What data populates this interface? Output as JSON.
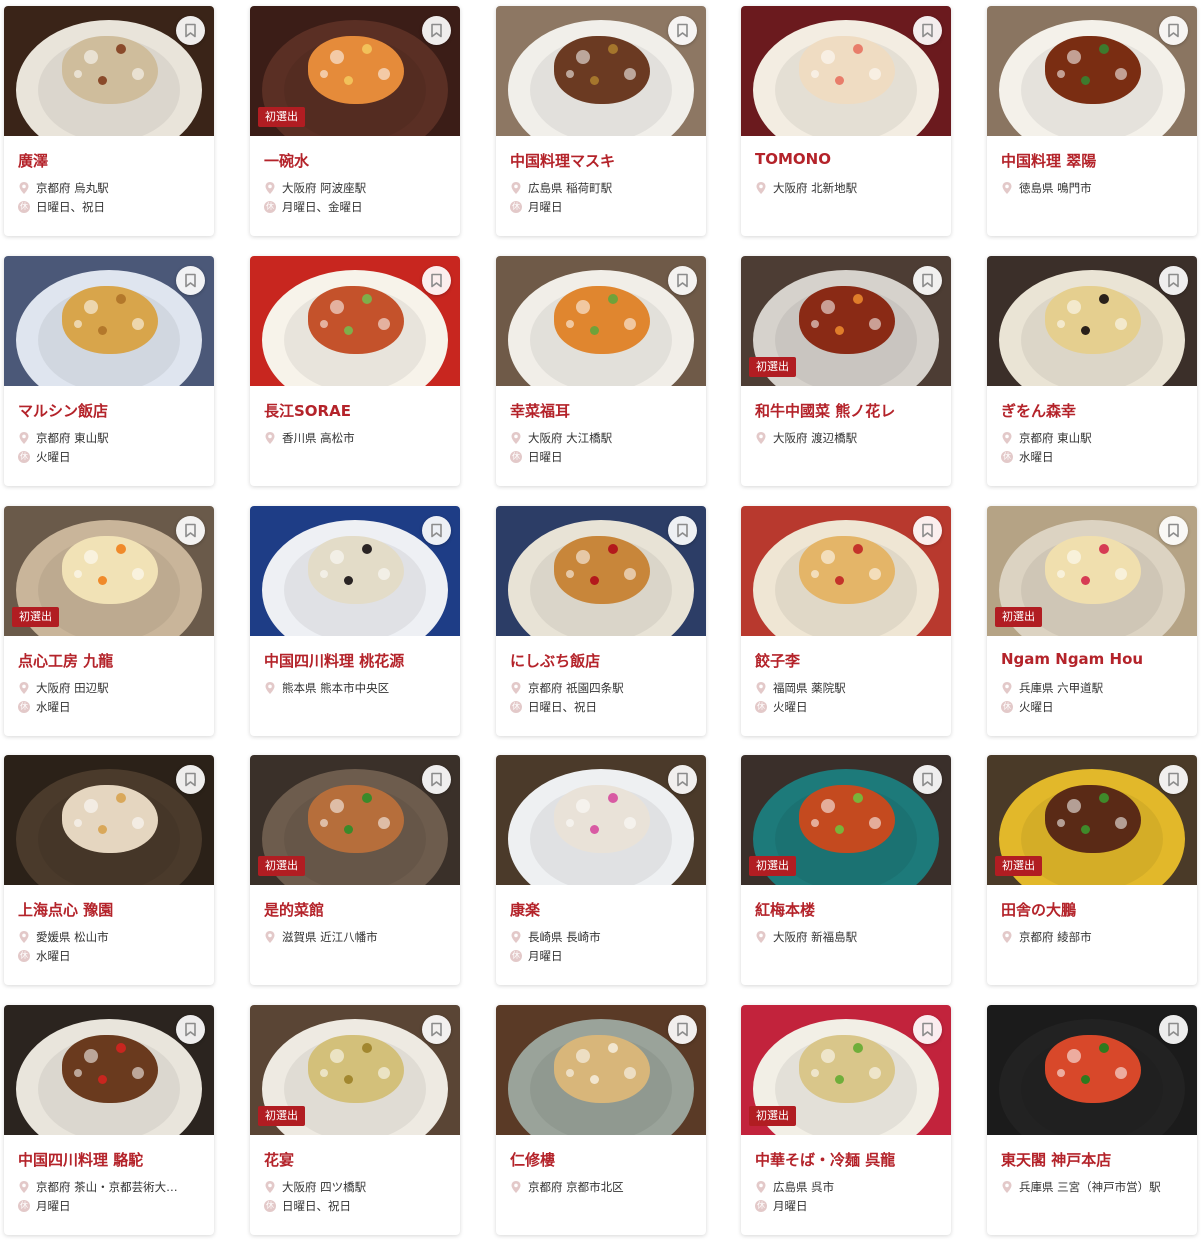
{
  "labels": {
    "first_selection": "初選出",
    "holiday_icon": "休"
  },
  "colors": {
    "accent": "#b4232a",
    "badge": "#b11d22"
  },
  "restaurants": [
    {
      "name": "廣澤",
      "location": "京都府 烏丸駅",
      "holiday": "日曜日、祝日",
      "badge": false,
      "photo": {
        "bg": "#3a2418",
        "plate": "#e9e4da",
        "food": "#cfbd9c",
        "accent": "#8a4a2a"
      }
    },
    {
      "name": "一碗水",
      "location": "大阪府 阿波座駅",
      "holiday": "月曜日、金曜日",
      "badge": true,
      "photo": {
        "bg": "#3b1d17",
        "plate": "#5a2f24",
        "food": "#e58b3a",
        "accent": "#f2c15a"
      }
    },
    {
      "name": "中国料理マスキ",
      "location": "広島県 稲荷町駅",
      "holiday": "月曜日",
      "badge": false,
      "photo": {
        "bg": "#8d7763",
        "plate": "#f1efea",
        "food": "#6b3a22",
        "accent": "#a5762c"
      }
    },
    {
      "name": "TOMONO",
      "location": "大阪府 北新地駅",
      "holiday": "",
      "badge": false,
      "photo": {
        "bg": "#6b1a1e",
        "plate": "#f3ede2",
        "food": "#efdcc2",
        "accent": "#e87d6a"
      }
    },
    {
      "name": "中国料理 翠陽",
      "location": "徳島県 鳴門市",
      "holiday": "",
      "badge": false,
      "photo": {
        "bg": "#8a7561",
        "plate": "#f4f1ea",
        "food": "#7a2d12",
        "accent": "#3d7a2d"
      }
    },
    {
      "name": "マルシン飯店",
      "location": "京都府 東山駅",
      "holiday": "火曜日",
      "badge": false,
      "photo": {
        "bg": "#4b5878",
        "plate": "#dfe5ef",
        "food": "#d8a54b",
        "accent": "#b3782b"
      }
    },
    {
      "name": "長江SORAE",
      "location": "香川県 高松市",
      "holiday": "",
      "badge": false,
      "photo": {
        "bg": "#c8261f",
        "plate": "#f7f3ea",
        "food": "#c4522b",
        "accent": "#7fae4a"
      }
    },
    {
      "name": "幸菜福耳",
      "location": "大阪府 大江橋駅",
      "holiday": "日曜日",
      "badge": false,
      "photo": {
        "bg": "#6f5a48",
        "plate": "#f1eee8",
        "food": "#e0862f",
        "accent": "#6fa23a"
      }
    },
    {
      "name": "和牛中國菜 熊ノ花レ",
      "location": "大阪府 渡辺橋駅",
      "holiday": "",
      "badge": true,
      "photo": {
        "bg": "#4d3d34",
        "plate": "#d6d2cc",
        "food": "#8a2a15",
        "accent": "#e07d2a"
      }
    },
    {
      "name": "ぎをん森幸",
      "location": "京都府 東山駅",
      "holiday": "水曜日",
      "badge": false,
      "photo": {
        "bg": "#3b2f29",
        "plate": "#eae4d5",
        "food": "#e5cf8f",
        "accent": "#2a211a"
      }
    },
    {
      "name": "点心工房 九龍",
      "location": "大阪府 田辺駅",
      "holiday": "水曜日",
      "badge": true,
      "photo": {
        "bg": "#6a5a4a",
        "plate": "#c9b59a",
        "food": "#f1e2b6",
        "accent": "#f08a2a"
      }
    },
    {
      "name": "中国四川料理 桃花源",
      "location": "熊本県 熊本市中央区",
      "holiday": "",
      "badge": false,
      "photo": {
        "bg": "#1e3d86",
        "plate": "#eef0f4",
        "food": "#e3dcc8",
        "accent": "#2a2424"
      }
    },
    {
      "name": "にしぶち飯店",
      "location": "京都府 祇園四条駅",
      "holiday": "日曜日、祝日",
      "badge": false,
      "photo": {
        "bg": "#2c3d66",
        "plate": "#e8e3d6",
        "food": "#c8863a",
        "accent": "#b3191c"
      }
    },
    {
      "name": "餃子李",
      "location": "福岡県 薬院駅",
      "holiday": "火曜日",
      "badge": false,
      "photo": {
        "bg": "#b8392e",
        "plate": "#efe6d4",
        "food": "#e4b568",
        "accent": "#c4332a"
      }
    },
    {
      "name": "Ngam Ngam Hou",
      "location": "兵庫県 六甲道駅",
      "holiday": "火曜日",
      "badge": true,
      "photo": {
        "bg": "#b5a385",
        "plate": "#dcd3c2",
        "food": "#f0dfae",
        "accent": "#d63c54"
      }
    },
    {
      "name": "上海点心 豫園",
      "location": "愛媛県 松山市",
      "holiday": "水曜日",
      "badge": false,
      "photo": {
        "bg": "#2b2118",
        "plate": "#4a3a2b",
        "food": "#e5d6c0",
        "accent": "#d9a85a"
      }
    },
    {
      "name": "是的菜館",
      "location": "滋賀県 近江八幡市",
      "holiday": "",
      "badge": true,
      "photo": {
        "bg": "#3a3029",
        "plate": "#6d5c4d",
        "food": "#b66e3b",
        "accent": "#3b8a2a"
      }
    },
    {
      "name": "康楽",
      "location": "長崎県 長崎市",
      "holiday": "月曜日",
      "badge": false,
      "photo": {
        "bg": "#4b3a2a",
        "plate": "#eef0f2",
        "food": "#e9e2d8",
        "accent": "#d85aa3"
      }
    },
    {
      "name": "紅梅本楼",
      "location": "大阪府 新福島駅",
      "holiday": "",
      "badge": true,
      "photo": {
        "bg": "#3a2f2a",
        "plate": "#1d7a7a",
        "food": "#c44a1f",
        "accent": "#7ab33a"
      }
    },
    {
      "name": "田舎の大鵬",
      "location": "京都府 綾部市",
      "holiday": "",
      "badge": true,
      "photo": {
        "bg": "#4a3a28",
        "plate": "#e2b82a",
        "food": "#5a2a16",
        "accent": "#3f8a2a"
      }
    },
    {
      "name": "中国四川料理 駱駝",
      "location": "京都府 茶山・京都芸術大…",
      "holiday": "月曜日",
      "badge": false,
      "photo": {
        "bg": "#2b241f",
        "plate": "#e9e5dc",
        "food": "#6a3a1e",
        "accent": "#c8261f"
      }
    },
    {
      "name": "花宴",
      "location": "大阪府 四ツ橋駅",
      "holiday": "日曜日、祝日",
      "badge": true,
      "photo": {
        "bg": "#5a4535",
        "plate": "#eeeae2",
        "food": "#d3c07a",
        "accent": "#a2872f"
      }
    },
    {
      "name": "仁修樓",
      "location": "京都府 京都市北区",
      "holiday": "",
      "badge": false,
      "photo": {
        "bg": "#5a3a26",
        "plate": "#9aa39a",
        "food": "#d8b67a",
        "accent": "#f2e6cf"
      }
    },
    {
      "name": "中華そば・冷麺 呉龍",
      "location": "広島県 呉市",
      "holiday": "月曜日",
      "badge": true,
      "photo": {
        "bg": "#c2233c",
        "plate": "#f2efe6",
        "food": "#d9c68a",
        "accent": "#6fae3a"
      }
    },
    {
      "name": "東天閣 神戸本店",
      "location": "兵庫県 三宮（神戸市営）駅",
      "holiday": "",
      "badge": false,
      "photo": {
        "bg": "#1b1b1b",
        "plate": "#222222",
        "food": "#d8482a",
        "accent": "#2f7a1e"
      }
    }
  ]
}
